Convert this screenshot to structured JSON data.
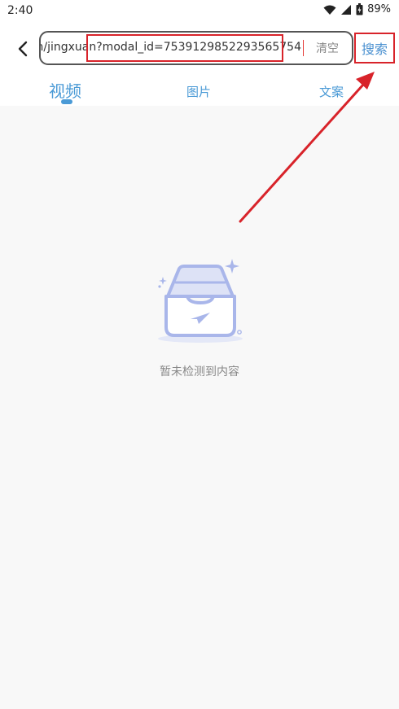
{
  "status_bar": {
    "time": "2:40",
    "battery": "89%"
  },
  "search": {
    "value": "n/jingxuan?modal_id=7539129852293565754",
    "clear_label": "清空",
    "button_label": "搜索"
  },
  "tabs": [
    {
      "label": "视频",
      "active": true
    },
    {
      "label": "图片",
      "active": false
    },
    {
      "label": "文案",
      "active": false
    }
  ],
  "empty_state": {
    "message": "暂未检测到内容"
  },
  "colors": {
    "accent": "#4a9ad6",
    "annotation": "#d8232a",
    "illustration": "#a9b6ea"
  },
  "icons": {
    "back": "chevron-left-icon",
    "wifi": "wifi-icon",
    "signal": "signal-icon",
    "battery": "battery-icon",
    "empty": "empty-box-icon"
  }
}
